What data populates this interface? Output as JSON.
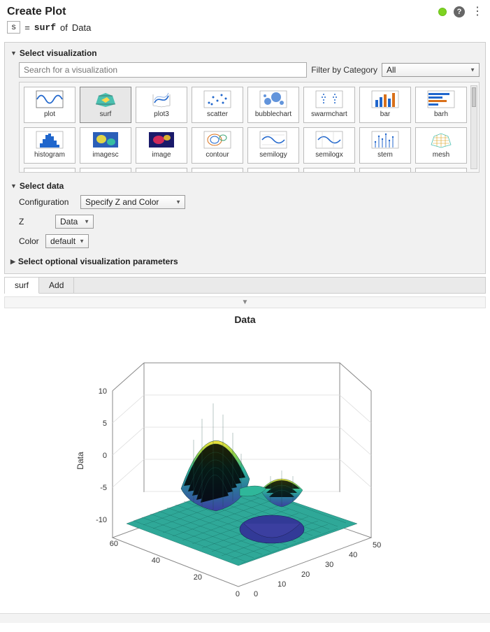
{
  "header": {
    "title": "Create Plot",
    "var_name": "s",
    "equals": "=",
    "func": "surf",
    "of": "of",
    "data_name": "Data"
  },
  "sections": {
    "select_viz": "Select visualization",
    "select_data": "Select data",
    "select_params": "Select optional visualization parameters"
  },
  "search": {
    "placeholder": "Search for a visualization",
    "filter_label": "Filter by Category",
    "filter_value": "All"
  },
  "viz_items": [
    {
      "id": "plot",
      "label": "plot"
    },
    {
      "id": "surf",
      "label": "surf"
    },
    {
      "id": "plot3",
      "label": "plot3"
    },
    {
      "id": "scatter",
      "label": "scatter"
    },
    {
      "id": "bubblechart",
      "label": "bubblechart"
    },
    {
      "id": "swarmchart",
      "label": "swarmchart"
    },
    {
      "id": "bar",
      "label": "bar"
    },
    {
      "id": "barh",
      "label": "barh"
    },
    {
      "id": "histogram",
      "label": "histogram"
    },
    {
      "id": "imagesc",
      "label": "imagesc"
    },
    {
      "id": "image",
      "label": "image"
    },
    {
      "id": "contour",
      "label": "contour"
    },
    {
      "id": "semilogy",
      "label": "semilogy"
    },
    {
      "id": "semilogx",
      "label": "semilogx"
    },
    {
      "id": "stem",
      "label": "stem"
    },
    {
      "id": "mesh",
      "label": "mesh"
    }
  ],
  "selected_viz": "surf",
  "data_form": {
    "config_label": "Configuration",
    "config_value": "Specify Z and Color",
    "z_label": "Z",
    "z_value": "Data",
    "color_label": "Color",
    "color_value": "default"
  },
  "tabs": {
    "active": "surf",
    "add": "Add"
  },
  "chart_data": {
    "type": "surface",
    "title": "Data",
    "zlabel": "Data",
    "x_range": [
      0,
      50
    ],
    "y_range": [
      0,
      60
    ],
    "z_range": [
      -10,
      10
    ],
    "x_ticks": [
      0,
      10,
      20,
      30,
      40,
      50
    ],
    "y_ticks": [
      0,
      20,
      40,
      60
    ],
    "z_ticks": [
      -10,
      -5,
      0,
      5,
      10
    ],
    "description": "peaks-like surface on a ~50x50 grid; one prominent positive peak near (x≈20,y≈35) reaching ~8, a secondary hump near (x≈32,y≈28) at ~3, and a deep negative trough near (x≈30,y≈18) reaching ~-6; base plane near z≈0"
  }
}
